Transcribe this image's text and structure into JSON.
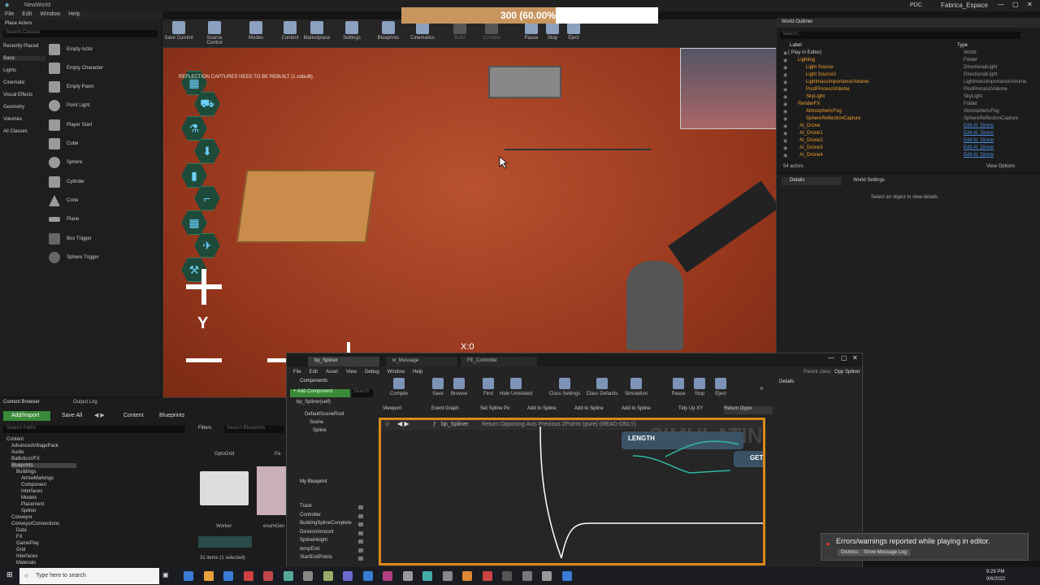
{
  "titlebar": {
    "app_title": "NewWorld",
    "user_label": "Fabrica_Espace",
    "tab_label": "PDC"
  },
  "menubar": {
    "items": [
      "File",
      "Edit",
      "Window",
      "Help"
    ]
  },
  "place_actors": {
    "title": "Place Actors",
    "search_placeholder": "Search Classes",
    "categories": [
      "Recently Placed",
      "Basic",
      "Lights",
      "Cinematic",
      "Visual Effects",
      "Geometry",
      "Volumes",
      "All Classes"
    ],
    "items": [
      "Empty Actor",
      "Empty Character",
      "Empty Pawn",
      "Point Light",
      "Player Start",
      "Cube",
      "Sphere",
      "Cylinder",
      "Cone",
      "Plane",
      "Box Trigger",
      "Sphere Trigger"
    ]
  },
  "toolbar": {
    "buttons": [
      "Save Current",
      "Source Control",
      "Modes",
      "Content",
      "Marketplace",
      "Settings",
      "Blueprints",
      "Cinematics",
      "Build",
      "Compile",
      "Pause",
      "Stop",
      "Eject"
    ]
  },
  "fps": {
    "text": "300 (60.00%",
    "fraction": 0.6
  },
  "viewport": {
    "warning": "REFLECTION CAPTURES NEED TO BE REBUILT (1 unbuilt)",
    "hud_y": "Y",
    "hud_x": "X:0"
  },
  "world_outliner": {
    "title": "World Outliner",
    "search_placeholder": "Search...",
    "col_label": "Label",
    "col_type": "Type",
    "rows": [
      {
        "name": "( Play In Editor)",
        "type": "World"
      },
      {
        "name": "Lighting",
        "type": "Folder"
      },
      {
        "name": "Light Source",
        "type": "DirectionalLight"
      },
      {
        "name": "Light Source2",
        "type": "DirectionalLight"
      },
      {
        "name": "LightmassImportanceVolume",
        "type": "LightmassImportanceVolume"
      },
      {
        "name": "PostProcessVolume",
        "type": "PostProcessVolume"
      },
      {
        "name": "SkyLight",
        "type": "SkyLight"
      },
      {
        "name": "RenderFX",
        "type": "Folder"
      },
      {
        "name": "AtmosphericFog",
        "type": "AtmosphericFog"
      },
      {
        "name": "SphereReflectionCapture",
        "type": "SphereReflectionCapture"
      },
      {
        "name": "AI_Drone",
        "type": "Edit AI_Drone"
      },
      {
        "name": "AI_Drone1",
        "type": "Edit AI_Drone"
      },
      {
        "name": "AI_Drone2",
        "type": "Edit AI_Drone"
      },
      {
        "name": "AI_Drone3",
        "type": "Edit AI_Drone"
      },
      {
        "name": "AI_Drone4",
        "type": "Edit AI_Drone"
      }
    ],
    "actor_count": "54 actors",
    "view_options": "View Options"
  },
  "details": {
    "tab_details": "Details",
    "tab_world_settings": "World Settings",
    "empty_msg": "Select an object to view details."
  },
  "content_browser": {
    "tab_cb": "Content Browser",
    "tab_log": "Output Log",
    "add_import": "Add/Import",
    "save_all": "Save All",
    "path": [
      "Content",
      "Blueprints"
    ],
    "search_paths": "Search Paths",
    "filters": "Filters",
    "search_bp": "Search Blueprints",
    "tree": [
      "Content",
      "AdvancedVillagePack",
      "Audio",
      "BallisticsVFX",
      "Blueprints",
      "Buildings",
      "ArrowMarkings",
      "Component",
      "Interfaces",
      "Models",
      "Placement",
      "Spliner",
      "Conveyor",
      "ConveyorConnections",
      "Data",
      "FX",
      "GamePlay",
      "Grid",
      "Interfaces",
      "Materials"
    ],
    "assets": [
      "OptoGrid",
      "Pa",
      "Worker",
      "enumGen"
    ],
    "status": "31 items (1 selected)"
  },
  "bp_editor": {
    "tabs": [
      "bp_Spliner",
      "w_Message",
      "FE_Controller"
    ],
    "menu": [
      "File",
      "Edit",
      "Asset",
      "View",
      "Debug",
      "Window",
      "Help"
    ],
    "parent_class": "Parent class:",
    "parent_value": "Opp Spliner",
    "components_title": "Components",
    "add_component": "+ Add Component",
    "search": "Search",
    "comp_self": "bp_Spliner(self)",
    "comp_tree": [
      "DefaultSceneRoot",
      "Scene",
      "Spline"
    ],
    "toolbar": [
      "Compile",
      "Save",
      "Browse",
      "Find",
      "Hide Unrelated",
      "Class Settings",
      "Class Defaults",
      "Simulation",
      "Pause",
      "Stop",
      "Eject"
    ],
    "graph_tabs": [
      "Viewport",
      "Event Graph",
      "Set Spline Po",
      "Add to Spline",
      "Add to Spline",
      "Add to Spline",
      "Tidy Up XY",
      "Return Oppo"
    ],
    "breadcrumb": "bp_Spliner",
    "function_title": "Return Opposing Axis Previous 2Points (pure)  (READ-ONLY)",
    "watermark": "SIMULATING",
    "node_length": "LENGTH",
    "node_get": "GET",
    "my_bp_title": "My Blueprint",
    "variables": [
      "Track",
      "Controller",
      "BuildingSplineComplete",
      "DivisionAmount",
      "SplineHeight",
      "tempEnd",
      "StartEndPoints"
    ],
    "details_title": "Details"
  },
  "toast": {
    "message": "Errors/warnings reported while playing in editor.",
    "dismiss": "Dismiss",
    "show_log": "Show Message Log"
  },
  "taskbar": {
    "search_placeholder": "Type here to search",
    "time": "9:29 PM",
    "date": "9/6/2022"
  }
}
